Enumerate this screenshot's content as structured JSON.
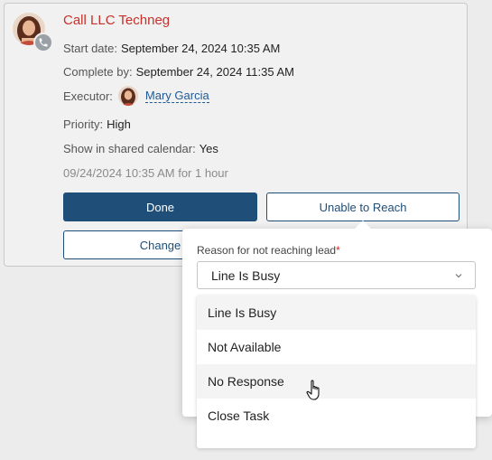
{
  "activity": {
    "title": "Call LLC Techneg",
    "start_label": "Start date:",
    "start_value": "September 24, 2024 10:35 AM",
    "complete_label": "Complete by:",
    "complete_value": "September 24, 2024 11:35 AM",
    "executor_label": "Executor:",
    "executor_name": "Mary Garcia",
    "priority_label": "Priority:",
    "priority_value": "High",
    "shared_label": "Show in shared calendar:",
    "shared_value": "Yes",
    "meta": "09/24/2024 10:35 AM for 1 hour",
    "icon": "phone-icon"
  },
  "buttons": {
    "done": "Done",
    "unable": "Unable to Reach",
    "change": "Change"
  },
  "popup": {
    "label": "Reason for not reaching lead",
    "required_mark": "*",
    "selected": "Line Is Busy",
    "options": [
      "Line Is Busy",
      "Not Available",
      "No Response",
      "Close Task"
    ]
  },
  "colors": {
    "title": "#c8312b",
    "primary": "#1f4e79",
    "link": "#1f5a96",
    "required": "#d92626"
  }
}
